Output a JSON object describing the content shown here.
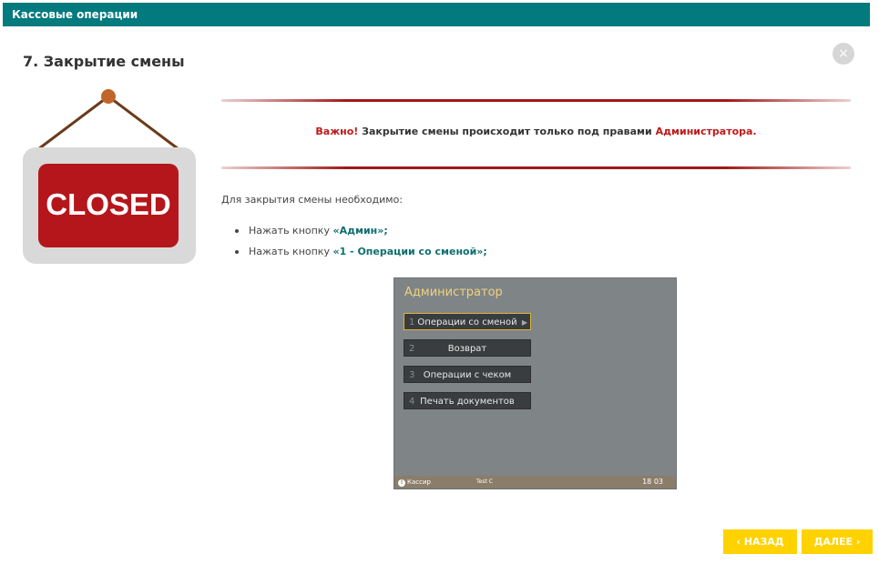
{
  "header": {
    "title": "Кассовые операции"
  },
  "close_label": "×",
  "page_title": "7. Закрытие смены",
  "sign": {
    "text": "CLOSED"
  },
  "notice": {
    "important": "Важно!",
    "text": " Закрытие смены происходит только под правами ",
    "role": "Администратора."
  },
  "intro": "Для закрытия смены необходимо:",
  "steps": [
    {
      "prefix": "Нажать кнопку ",
      "highlight": "«Админ»;"
    },
    {
      "prefix": "Нажать кнопку ",
      "highlight": "«1 - Операции со сменой»;"
    }
  ],
  "pos_screen": {
    "title": "Администратор",
    "menu": [
      {
        "num": "1",
        "label": "Операции со сменой",
        "active": true
      },
      {
        "num": "2",
        "label": "Возврат"
      },
      {
        "num": "3",
        "label": "Операции с чеком"
      },
      {
        "num": "4",
        "label": "Печать документов"
      }
    ],
    "status": {
      "cashier": "Кассир",
      "test": "Test C",
      "time": "18 03"
    }
  },
  "nav": {
    "back_label": "‹  НАЗАД",
    "next_label": "ДАЛЕЕ  ›"
  },
  "colors": {
    "header": "#027a7e",
    "accent_red": "#c0181b",
    "highlight": "#0e6e70",
    "nav": "#ffd200"
  }
}
